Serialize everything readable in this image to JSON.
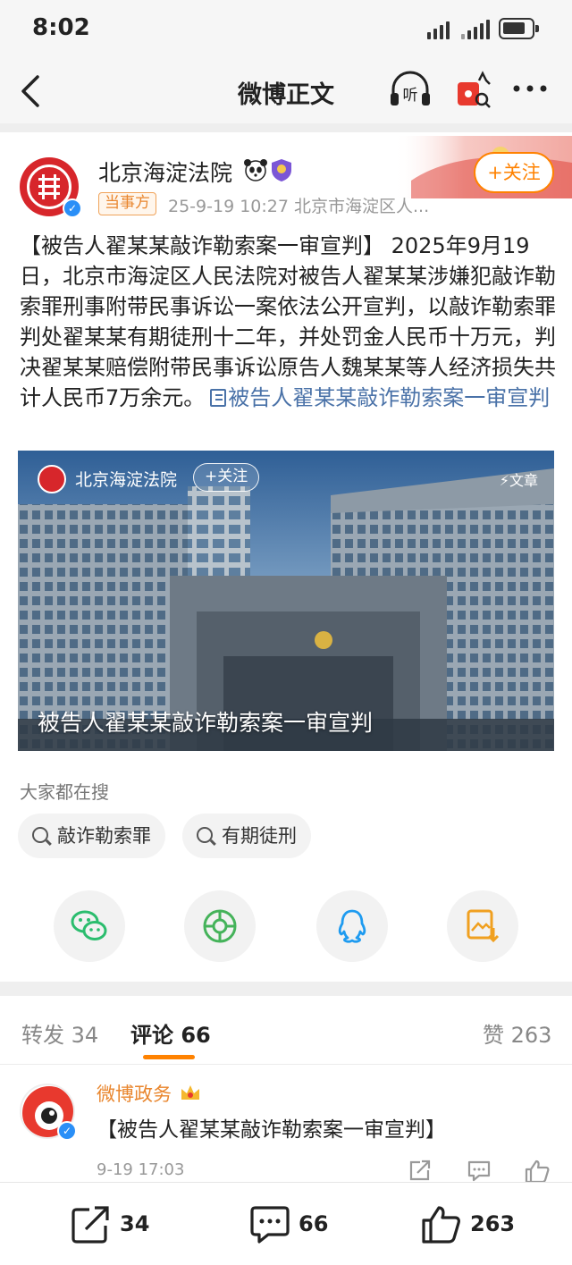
{
  "status_bar": {
    "time": "8:02"
  },
  "nav": {
    "title": "微博正文"
  },
  "post": {
    "author": "北京海淀法院",
    "tag": "当事方",
    "meta": "25-9-19 10:27  北京市海淀区人...",
    "follow_label": "+关注",
    "text_main": "【被告人翟某某敲诈勒索案一审宣判】 2025年9月19日，北京市海淀区人民法院对被告人翟某某涉嫌犯敲诈勒索罪刑事附带民事诉讼一案依法公开宣判，以敲诈勒索罪判处翟某某有期徒刑十二年，并处罚金人民币十万元，判决翟某某赔偿附带民事诉讼原告人魏某某等人经济损失共计人民币7万余元。",
    "text_link": "被告人翟某某敲诈勒索案一审宣判"
  },
  "article_card": {
    "source": "北京海淀法院",
    "follow_label": "+关注",
    "type_label": "文章",
    "title": "被告人翟某某敲诈勒索案一审宣判"
  },
  "hot_search": {
    "label": "大家都在搜",
    "chips": [
      "敲诈勒索罪",
      "有期徒刑"
    ]
  },
  "tabs": {
    "repost_label": "转发",
    "repost_count": "34",
    "comment_label": "评论",
    "comment_count": "66",
    "like_label": "赞",
    "like_count": "263"
  },
  "comment": {
    "author": "微博政务",
    "text": "【被告人翟某某敲诈勒索案一审宣判】",
    "time": "9-19 17:03"
  },
  "bottom_bar": {
    "repost": "34",
    "comment": "66",
    "like": "263"
  },
  "colors": {
    "accent": "#ff8200",
    "link": "#4a72a8",
    "court_red": "#d7262b",
    "wechat_green": "#2bbd6e",
    "qq_blue": "#1e9bf0"
  },
  "icons": [
    "back-icon",
    "listen-icon",
    "gift-icon",
    "more-icon",
    "panda-icon",
    "shield-icon",
    "wechat-icon",
    "moments-icon",
    "qq-icon",
    "save-image-icon",
    "search-icon",
    "repost-icon",
    "comment-icon",
    "like-icon"
  ]
}
